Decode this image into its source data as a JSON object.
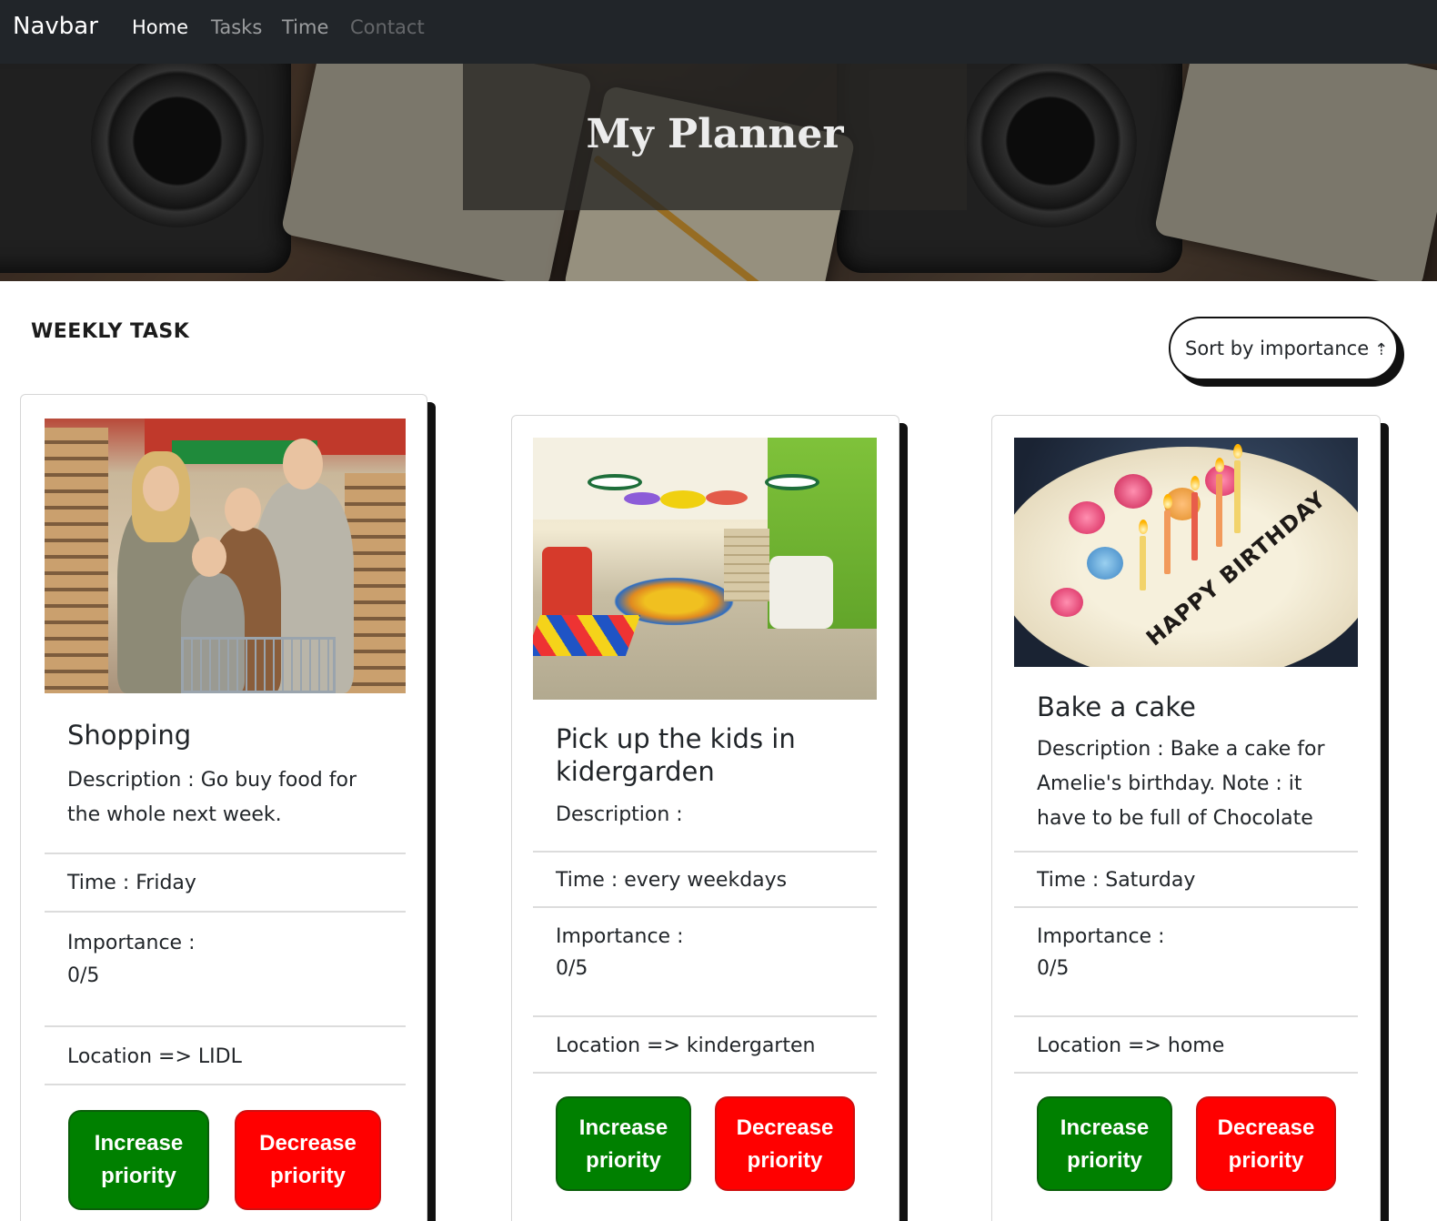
{
  "navbar": {
    "brand": "Navbar",
    "links": [
      {
        "label": "Home"
      },
      {
        "label": "Tasks"
      },
      {
        "label": "Time"
      },
      {
        "label": "Contact"
      }
    ]
  },
  "hero": {
    "title": "My Planner"
  },
  "section": {
    "heading": "WEEKLY TASK",
    "sort_label": "Sort by importance",
    "sort_icon": "arrow-up-icon",
    "sort_glyph": "⇡"
  },
  "tasks": [
    {
      "image": "shopping-photo",
      "title": "Shopping",
      "description": "Description : Go buy food for the whole next week.",
      "time": "Time : Friday",
      "importance_label": "Importance :",
      "importance_value": "0/5",
      "location": "Location => LIDL",
      "increase_line1": "Increase",
      "increase_line2": "priority",
      "decrease_line1": "Decrease",
      "decrease_line2": "priority"
    },
    {
      "image": "kindergarten-photo",
      "title": "Pick up the kids in kidergarden",
      "description": "Description :",
      "time": "Time : every weekdays",
      "importance_label": "Importance :",
      "importance_value": "0/5",
      "location": "Location => kindergarten",
      "increase_line1": "Increase",
      "increase_line2": "priority",
      "decrease_line1": "Decrease",
      "decrease_line2": "priority"
    },
    {
      "image": "birthday-cake-photo",
      "image_text": "HAPPY BIRTHDAY",
      "title": "Bake a cake",
      "description": "Description : Bake a cake for Amelie's birthday. Note : it have to be full of Chocolate",
      "time": "Time : Saturday",
      "importance_label": "Importance :",
      "importance_value": "0/5",
      "location": "Location => home",
      "increase_line1": "Increase",
      "increase_line2": "priority",
      "decrease_line1": "Decrease",
      "decrease_line2": "priority"
    }
  ],
  "colors": {
    "navbar_bg": "#212529",
    "increase_button": "#008000",
    "decrease_button": "#ff0000"
  }
}
